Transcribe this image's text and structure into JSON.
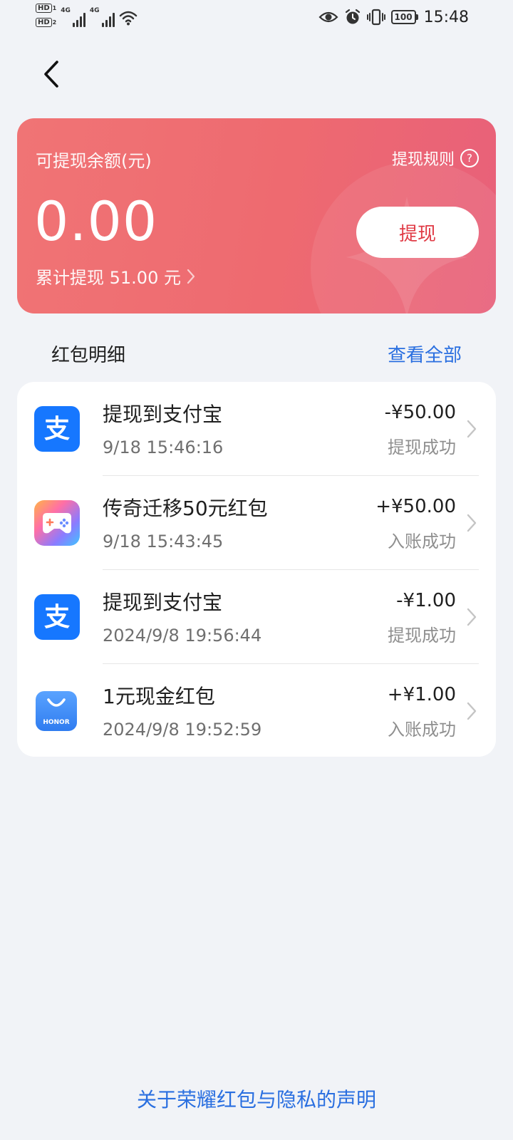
{
  "status_bar": {
    "time": "15:48",
    "battery": "100",
    "sim1_label": "HD",
    "sim1_index": "1",
    "sim2_label": "HD",
    "sim2_index": "2",
    "net1": "4G",
    "net2": "4G"
  },
  "balance_card": {
    "label": "可提现余额(元)",
    "rules_label": "提现规则",
    "amount": "0.00",
    "total_withdrawn": "累计提现 51.00 元",
    "withdraw_button": "提现"
  },
  "section": {
    "title": "红包明细",
    "view_all": "查看全部"
  },
  "transactions": [
    {
      "icon": "alipay-icon",
      "title": "提现到支付宝",
      "time": "9/18 15:46:16",
      "amount": "-¥50.00",
      "status": "提现成功"
    },
    {
      "icon": "game-controller-icon",
      "title": "传奇迁移50元红包",
      "time": "9/18 15:43:45",
      "amount": "+¥50.00",
      "status": "入账成功"
    },
    {
      "icon": "alipay-icon",
      "title": "提现到支付宝",
      "time": "2024/9/8 19:56:44",
      "amount": "-¥1.00",
      "status": "提现成功"
    },
    {
      "icon": "honor-store-icon",
      "title": "1元现金红包",
      "time": "2024/9/8 19:52:59",
      "amount": "+¥1.00",
      "status": "入账成功"
    }
  ],
  "honor_logo_text": "HONOR",
  "alipay_glyph": "支",
  "footer_link": "关于荣耀红包与隐私的声明",
  "colors": {
    "accent_blue": "#2a6fe0",
    "card_red": "#ef6c72",
    "withdraw_text": "#e03a45",
    "alipay_blue": "#1677ff",
    "honor_blue": "#3d8bff"
  }
}
